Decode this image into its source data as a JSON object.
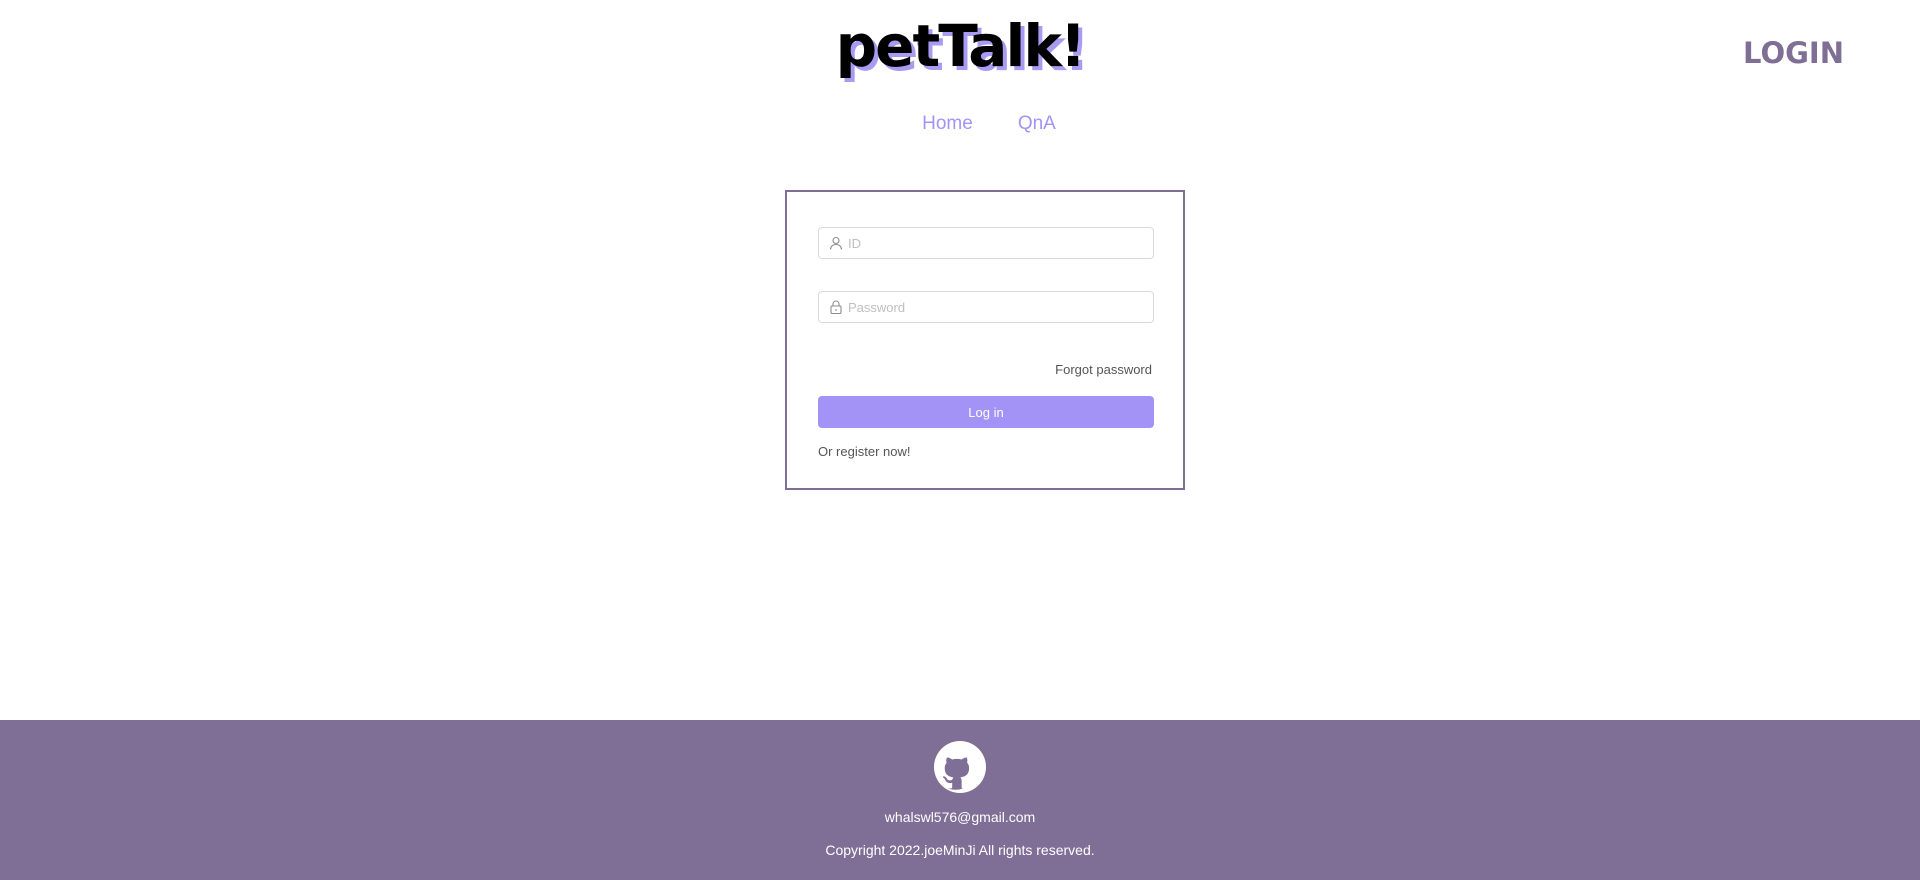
{
  "header": {
    "logo": "petTalk!",
    "login_label": "LOGIN"
  },
  "nav": {
    "items": [
      {
        "label": "Home"
      },
      {
        "label": "QnA"
      }
    ]
  },
  "login_form": {
    "id_placeholder": "ID",
    "id_icon": "user-icon",
    "password_placeholder": "Password",
    "password_icon": "lock-icon",
    "forgot_label": "Forgot password",
    "submit_label": "Log in",
    "register_label": "Or register now!"
  },
  "footer": {
    "icon": "github-icon",
    "email": "whalswl576@gmail.com",
    "copyright": "Copyright 2022.joeMinJi All rights reserved."
  },
  "colors": {
    "accent": "#a493f6",
    "brand": "#7f6e95",
    "footer_bg": "#7f6e95"
  }
}
